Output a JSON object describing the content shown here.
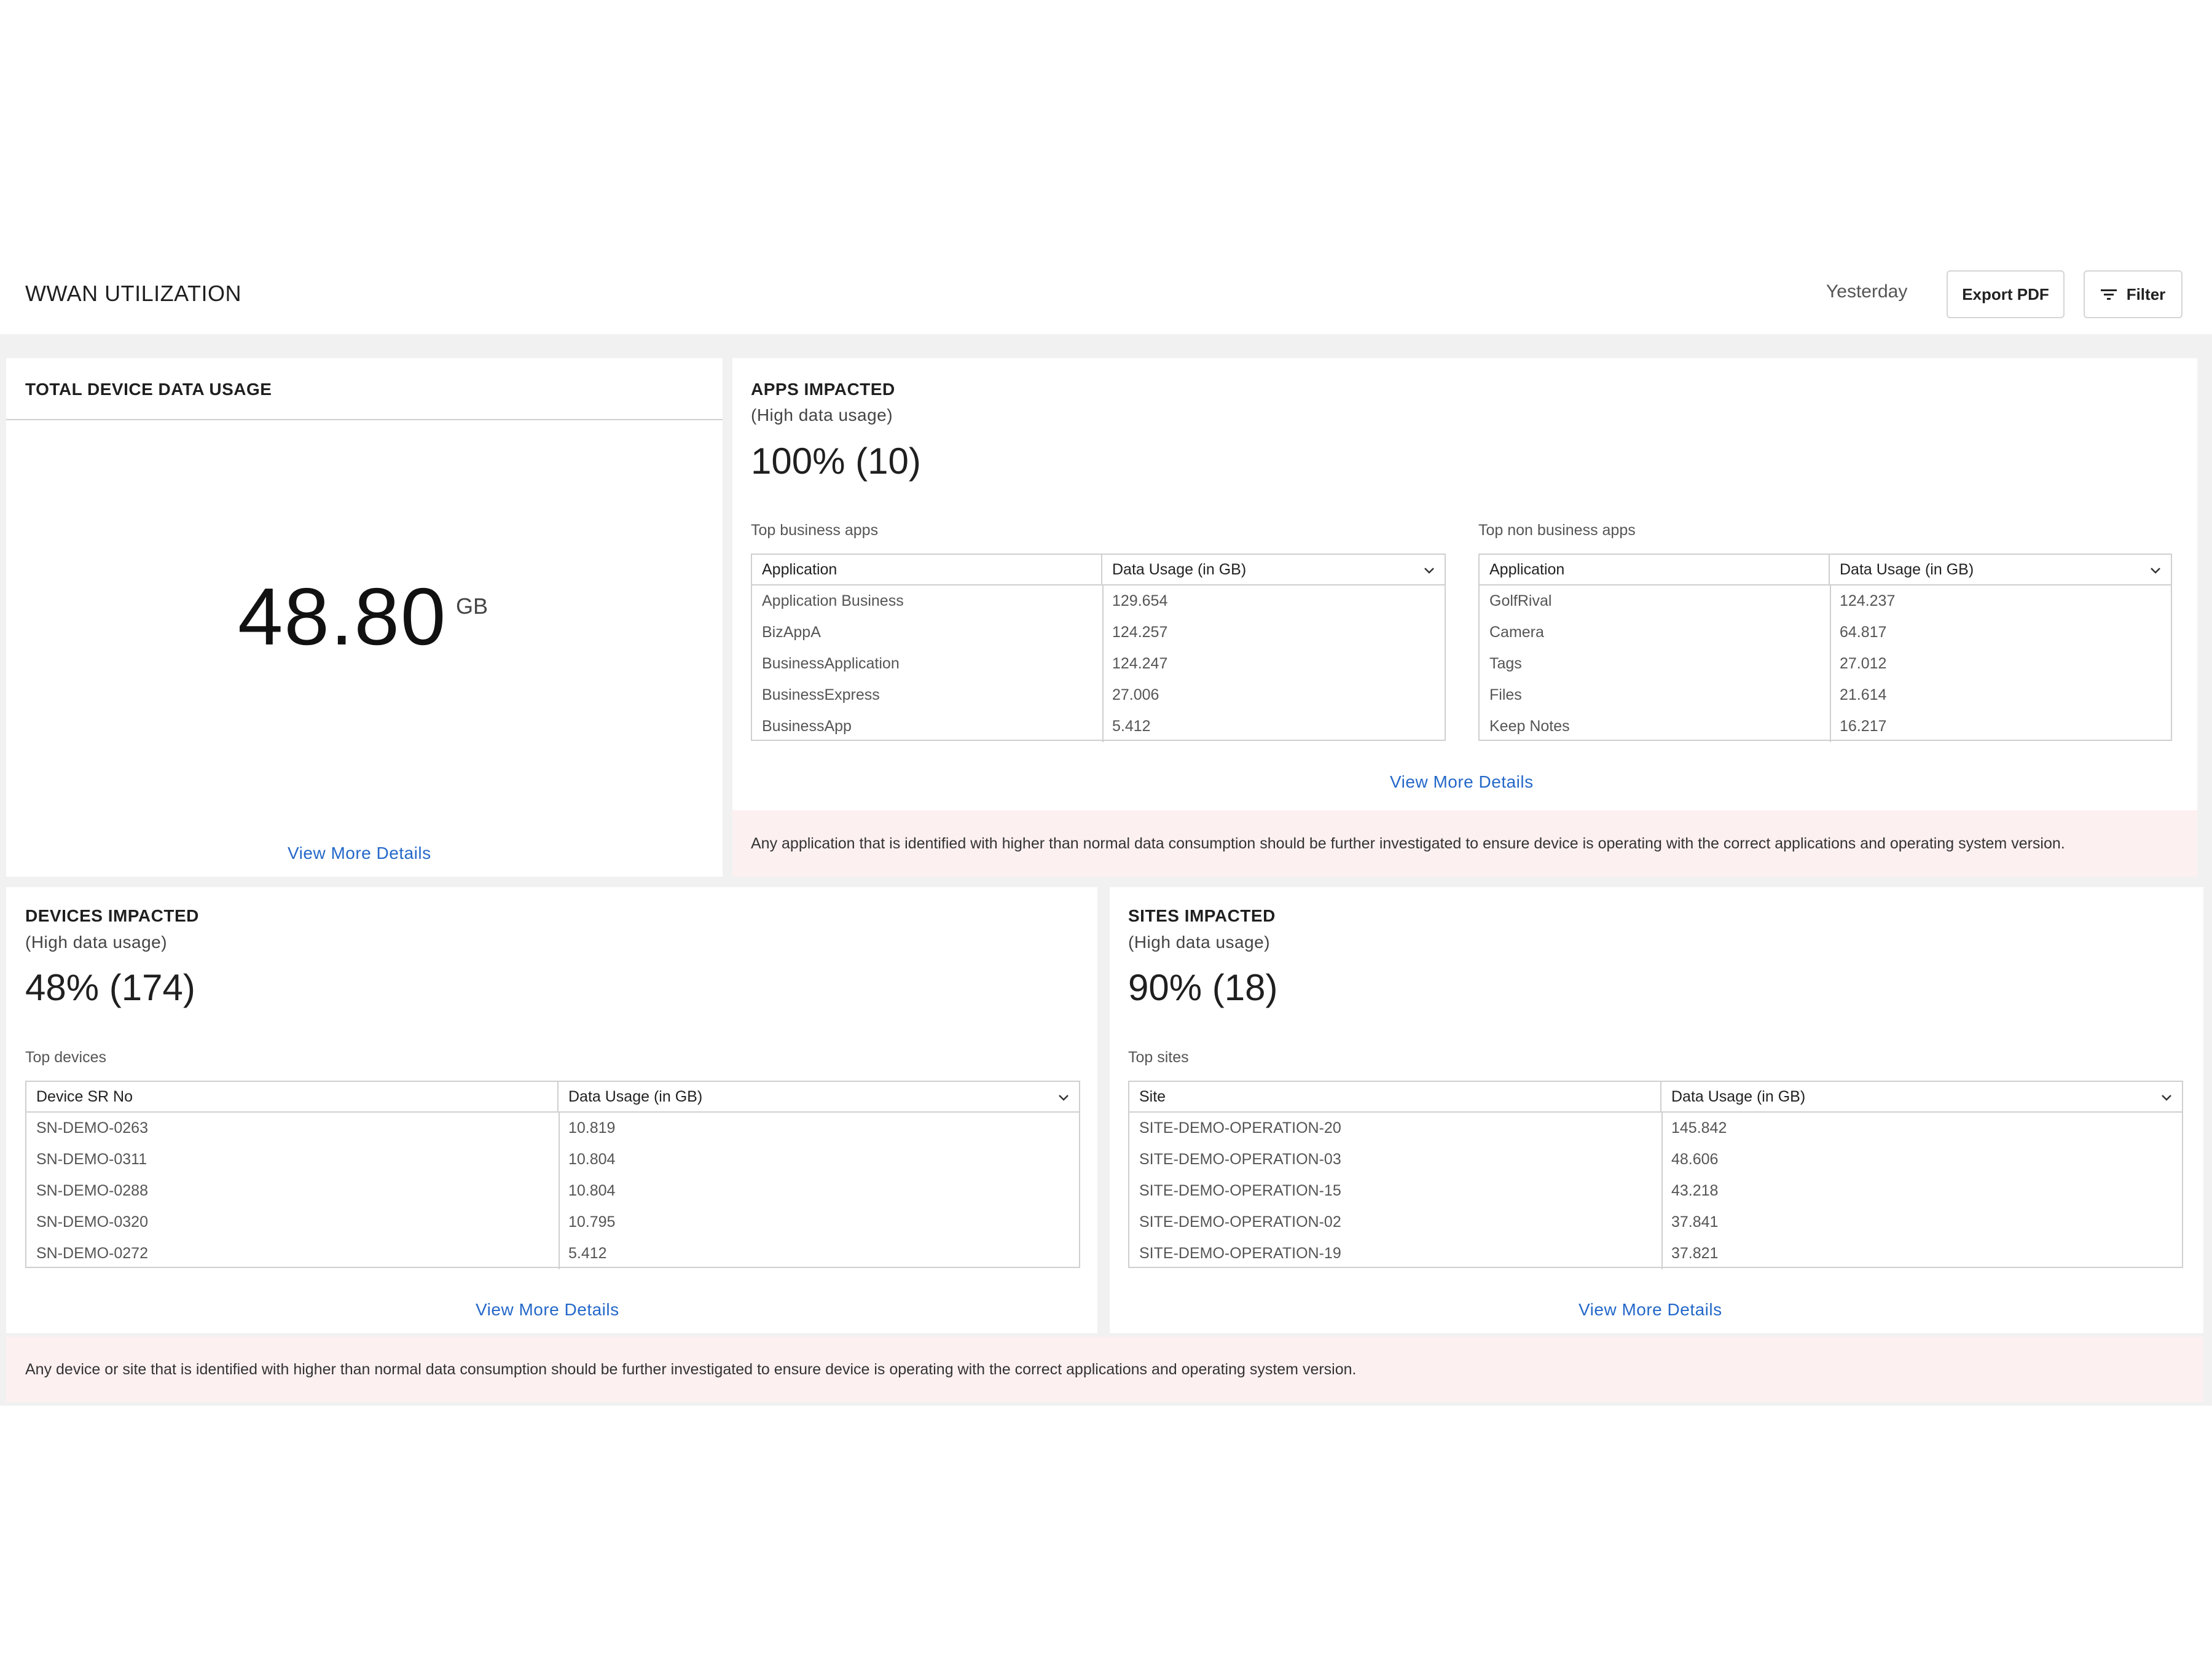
{
  "header": {
    "title": "WWAN UTILIZATION",
    "period": "Yesterday",
    "export_label": "Export PDF",
    "filter_label": "Filter"
  },
  "total": {
    "title": "TOTAL DEVICE DATA USAGE",
    "value": "48.80",
    "unit": "GB",
    "link": "View More Details"
  },
  "apps": {
    "title": "APPS IMPACTED",
    "subtitle": "(High data usage)",
    "percent": "100% (10)",
    "business": {
      "label": "Top business apps",
      "columns": [
        "Application",
        "Data Usage (in GB)"
      ],
      "rows": [
        [
          "Application Business",
          "129.654"
        ],
        [
          "BizAppA",
          "124.257"
        ],
        [
          "BusinessApplication",
          "124.247"
        ],
        [
          "BusinessExpress",
          "27.006"
        ],
        [
          "BusinessApp",
          "5.412"
        ]
      ]
    },
    "non_business": {
      "label": "Top non business apps",
      "columns": [
        "Application",
        "Data Usage (in GB)"
      ],
      "rows": [
        [
          "GolfRival",
          "124.237"
        ],
        [
          "Camera",
          "64.817"
        ],
        [
          "Tags",
          "27.012"
        ],
        [
          "Files",
          "21.614"
        ],
        [
          "Keep Notes",
          "16.217"
        ]
      ]
    },
    "link": "View More Details",
    "note": "Any application that is identified with higher than normal data consumption should be further investigated to ensure device is operating with the correct applications and operating system version."
  },
  "devices": {
    "title": "DEVICES IMPACTED",
    "subtitle": "(High data usage)",
    "percent": "48% (174)",
    "label": "Top devices",
    "columns": [
      "Device SR No",
      "Data Usage (in GB)"
    ],
    "rows": [
      [
        "SN-DEMO-0263",
        "10.819"
      ],
      [
        "SN-DEMO-0311",
        "10.804"
      ],
      [
        "SN-DEMO-0288",
        "10.804"
      ],
      [
        "SN-DEMO-0320",
        "10.795"
      ],
      [
        "SN-DEMO-0272",
        "5.412"
      ]
    ],
    "link": "View More Details"
  },
  "sites": {
    "title": "SITES IMPACTED",
    "subtitle": "(High data usage)",
    "percent": "90% (18)",
    "label": "Top sites",
    "columns": [
      "Site",
      "Data Usage (in GB)"
    ],
    "rows": [
      [
        "SITE-DEMO-OPERATION-20",
        "145.842"
      ],
      [
        "SITE-DEMO-OPERATION-03",
        "48.606"
      ],
      [
        "SITE-DEMO-OPERATION-15",
        "43.218"
      ],
      [
        "SITE-DEMO-OPERATION-02",
        "37.841"
      ],
      [
        "SITE-DEMO-OPERATION-19",
        "37.821"
      ]
    ],
    "link": "View More Details"
  },
  "device_note": "Any device or site that is identified with higher than normal data consumption should be further investigated to ensure device is operating with the correct applications and operating system version.",
  "colors": {
    "link": "#2468c9",
    "note_background": "#fdf0f1",
    "panel_background": "#f1f1f1"
  }
}
